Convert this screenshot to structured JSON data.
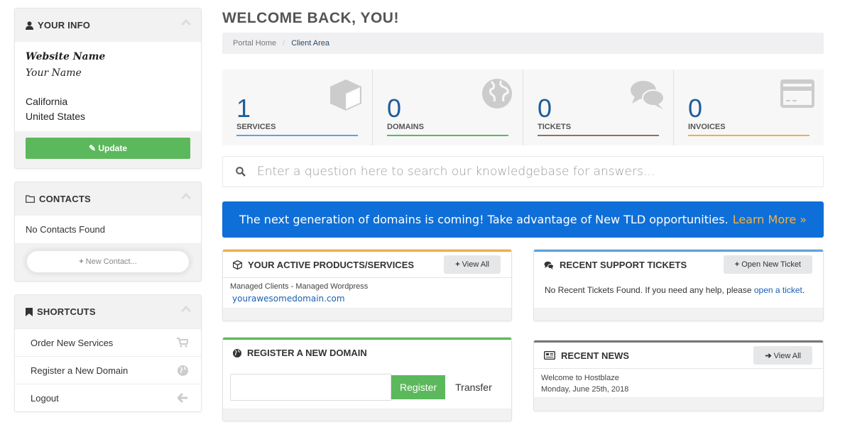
{
  "sidebar": {
    "your_info": {
      "title": "YOUR INFO",
      "website_name": "Website Name",
      "your_name": "Your Name",
      "state": "California",
      "country": "United States",
      "update_label": "Update"
    },
    "contacts": {
      "title": "CONTACTS",
      "empty_text": "No Contacts Found",
      "new_contact_label": "New Contact..."
    },
    "shortcuts": {
      "title": "SHORTCUTS",
      "items": [
        {
          "label": "Order New Services",
          "icon": "cart-icon"
        },
        {
          "label": "Register a New Domain",
          "icon": "globe-icon"
        },
        {
          "label": "Logout",
          "icon": "arrow-left-icon"
        }
      ]
    }
  },
  "main": {
    "page_title": "WELCOME BACK, YOU!",
    "breadcrumb": [
      {
        "label": "Portal Home"
      },
      {
        "label": "Client Area"
      }
    ],
    "breadcrumb_sep": "/",
    "tiles": [
      {
        "count": "1",
        "label": "SERVICES",
        "color": "#5ba4e0",
        "icon": "cube-icon"
      },
      {
        "count": "0",
        "label": "DOMAINS",
        "color": "#5cb85c",
        "icon": "globe-icon"
      },
      {
        "count": "0",
        "label": "TICKETS",
        "color": "#8a7558",
        "icon": "comments-icon"
      },
      {
        "count": "0",
        "label": "INVOICES",
        "color": "#f0ad4e",
        "icon": "credit-card-icon"
      }
    ],
    "kb_search": {
      "placeholder": "Enter a question here to search our knowledgebase for answers..."
    },
    "promo": {
      "text": "The next generation of domains is coming! Take advantage of New TLD opportunities.",
      "link": "Learn More »"
    },
    "products": {
      "title": "YOUR ACTIVE PRODUCTS/SERVICES",
      "button": "View All",
      "accent": "#f0ad4e",
      "item_name": "Managed Clients - Managed Wordpress",
      "item_domain": "yourawesomedomain.com"
    },
    "support": {
      "title": "RECENT SUPPORT TICKETS",
      "button": "Open New Ticket",
      "accent": "#5ba4e0",
      "text_before": "No Recent Tickets Found. If you need any help, please ",
      "link": "open a ticket",
      "text_after": "."
    },
    "register": {
      "title": "REGISTER A NEW DOMAIN",
      "accent": "#5cb85c",
      "domain_value": "",
      "register_label": "Register",
      "transfer_label": "Transfer"
    },
    "news": {
      "title": "RECENT NEWS",
      "button": "View All",
      "accent": "#777777",
      "headline": "Welcome to Hostblaze",
      "date": "Monday, June 25th, 2018"
    }
  }
}
